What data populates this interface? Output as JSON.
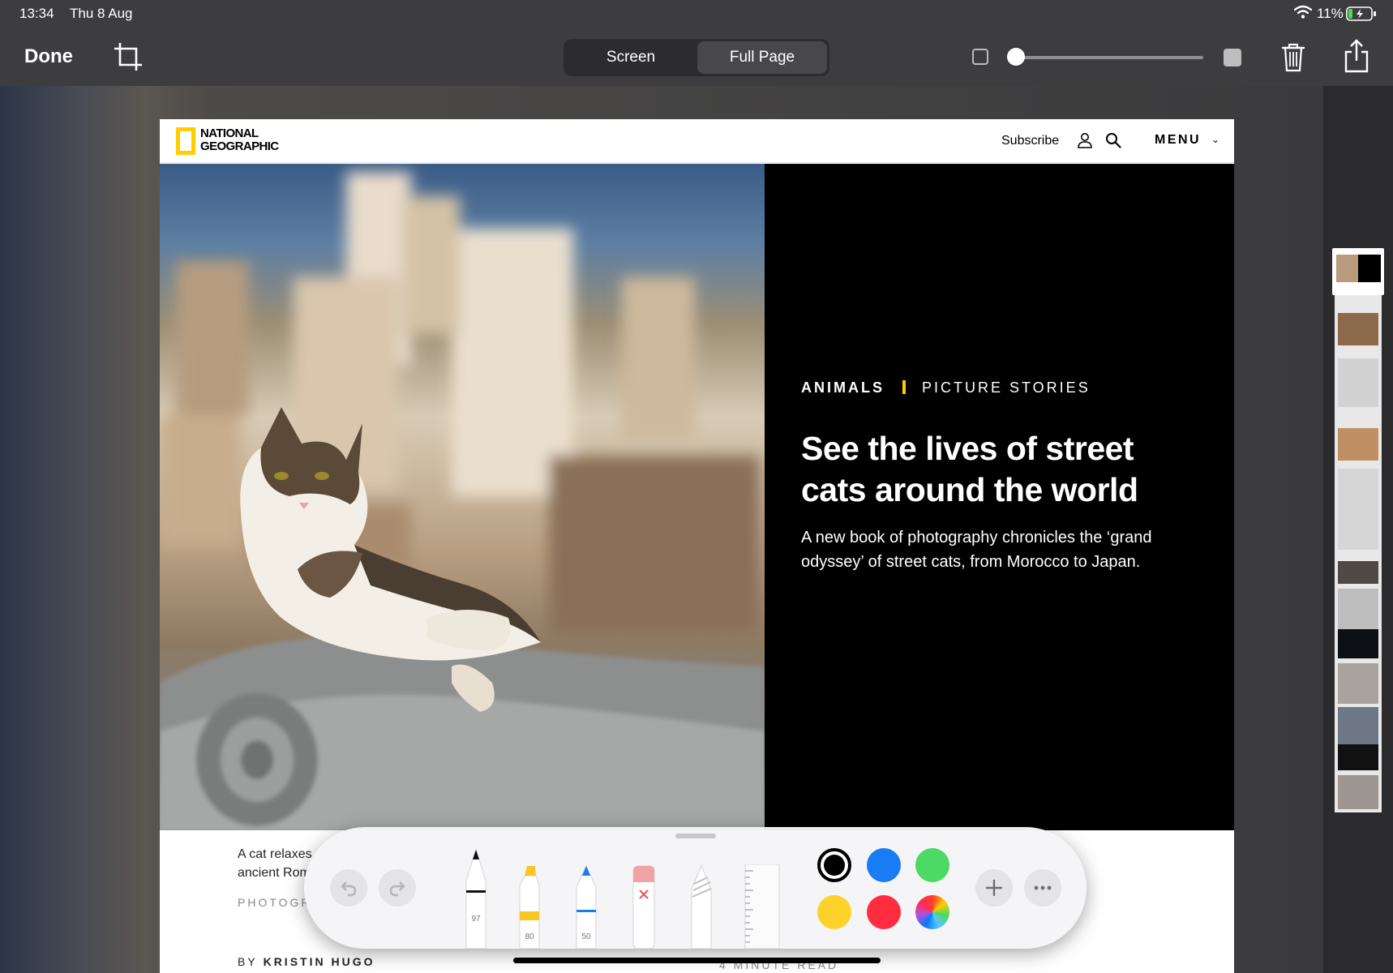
{
  "status_bar": {
    "time": "13:34",
    "date": "Thu 8 Aug",
    "battery_percent": "11%"
  },
  "toolbar": {
    "done_label": "Done",
    "segment": {
      "options": [
        "Screen",
        "Full Page"
      ],
      "selected": "Full Page"
    },
    "opacity_level": 0.0
  },
  "article": {
    "brand": "NATIONAL GEOGRAPHIC",
    "brand_line1": "NATIONAL",
    "brand_line2": "GEOGRAPHIC",
    "nav": {
      "subscribe": "Subscribe",
      "menu": "MENU"
    },
    "kicker_primary": "ANIMALS",
    "kicker_secondary": "PICTURE STORIES",
    "headline": "See the lives of street cats around the world",
    "dek": "A new book of photography chronicles the ‘grand odyssey’ of street cats, from Morocco to Japan.",
    "caption": "A cat relaxes ancient Rom",
    "photographer_label": "PHOTOGR",
    "byline_prefix": "BY",
    "author": "KRISTIN HUGO",
    "read_time": "4 MINUTE READ"
  },
  "markup_tools": {
    "pen_width": "97",
    "highlighter_width": "80",
    "pencil_width": "50",
    "colors": [
      "#000000",
      "#1a7cf5",
      "#4cd964",
      "#ffd12b",
      "#ff2d3f",
      "rainbow"
    ],
    "selected_color": "#000000"
  },
  "icons": {
    "crop": "crop-icon",
    "trash": "trash-icon",
    "share": "share-icon",
    "undo": "undo-icon",
    "redo": "redo-icon",
    "add": "plus-icon",
    "more": "ellipsis-icon"
  }
}
